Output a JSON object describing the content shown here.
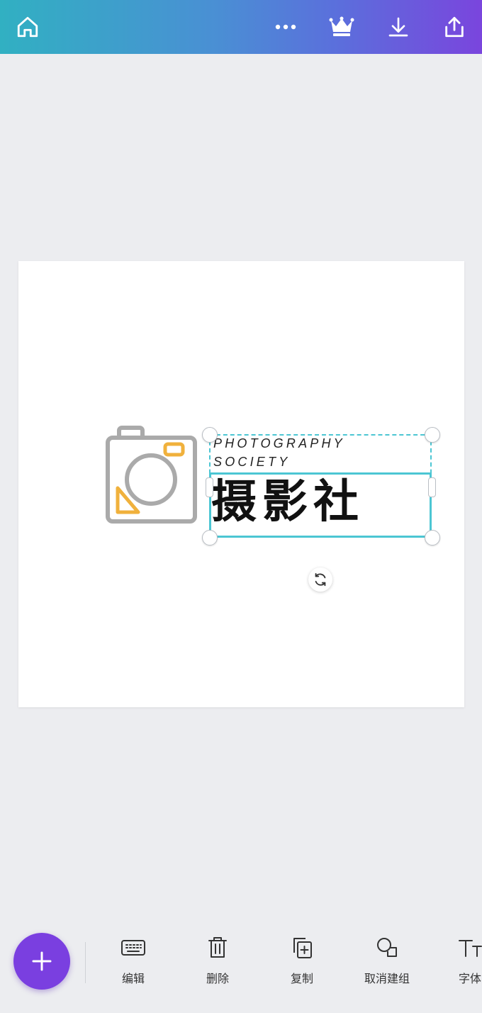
{
  "topbar": {
    "icons": [
      "home-icon",
      "more-icon",
      "crown-icon",
      "download-icon",
      "share-icon"
    ]
  },
  "design": {
    "title_en": "PHOTOGRAPHY\nSOCIETY",
    "title_cn": "摄影社",
    "logo_icon": "camera-icon",
    "colors": {
      "camera_gray": "#aaaaaa",
      "camera_accent": "#f0b13c",
      "selection": "#4cc6d3"
    }
  },
  "toolbar": {
    "add_icon": "plus-icon",
    "tools": [
      {
        "label": "编辑",
        "icon": "keyboard-icon"
      },
      {
        "label": "删除",
        "icon": "trash-icon"
      },
      {
        "label": "复制",
        "icon": "copy-icon"
      },
      {
        "label": "取消建组",
        "icon": "ungroup-icon"
      },
      {
        "label": "字体",
        "icon": "font-icon"
      }
    ],
    "fab_color": "#7a3fe0"
  }
}
